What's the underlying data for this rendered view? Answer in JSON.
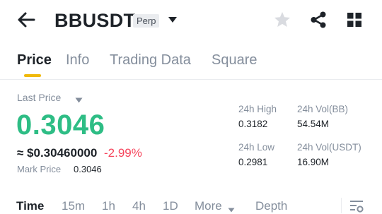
{
  "header": {
    "symbol": "BBUSDT",
    "badge": "Perp",
    "icons": {
      "back": "back-arrow-icon",
      "caret": "caret-down-icon",
      "favorite": "star-icon",
      "share": "share-icon",
      "menu": "grid-icon"
    }
  },
  "tabs": [
    {
      "label": "Price",
      "active": true
    },
    {
      "label": "Info",
      "active": false
    },
    {
      "label": "Trading Data",
      "active": false
    },
    {
      "label": "Square",
      "active": false
    }
  ],
  "price": {
    "last_price_label": "Last Price",
    "last_price": "0.3046",
    "usd_equivalent": "≈ $0.30460000",
    "change_percent": "-2.99%",
    "mark_price_label": "Mark Price",
    "mark_price": "0.3046"
  },
  "stats": {
    "high_label": "24h High",
    "high_value": "0.3182",
    "low_label": "24h Low",
    "low_value": "0.2981",
    "vol_base_label": "24h Vol(BB)",
    "vol_base_value": "54.54M",
    "vol_quote_label": "24h Vol(USDT)",
    "vol_quote_value": "16.90M"
  },
  "intervals": [
    {
      "label": "Time",
      "active": true
    },
    {
      "label": "15m",
      "active": false
    },
    {
      "label": "1h",
      "active": false
    },
    {
      "label": "4h",
      "active": false
    },
    {
      "label": "1D",
      "active": false
    },
    {
      "label": "More",
      "active": false
    },
    {
      "label": "Depth",
      "active": false
    }
  ],
  "colors": {
    "up": "#2ebd85",
    "down": "#f6465d",
    "accent": "#f0b90b",
    "text_primary": "#1e2329",
    "text_secondary": "#848e9c"
  }
}
